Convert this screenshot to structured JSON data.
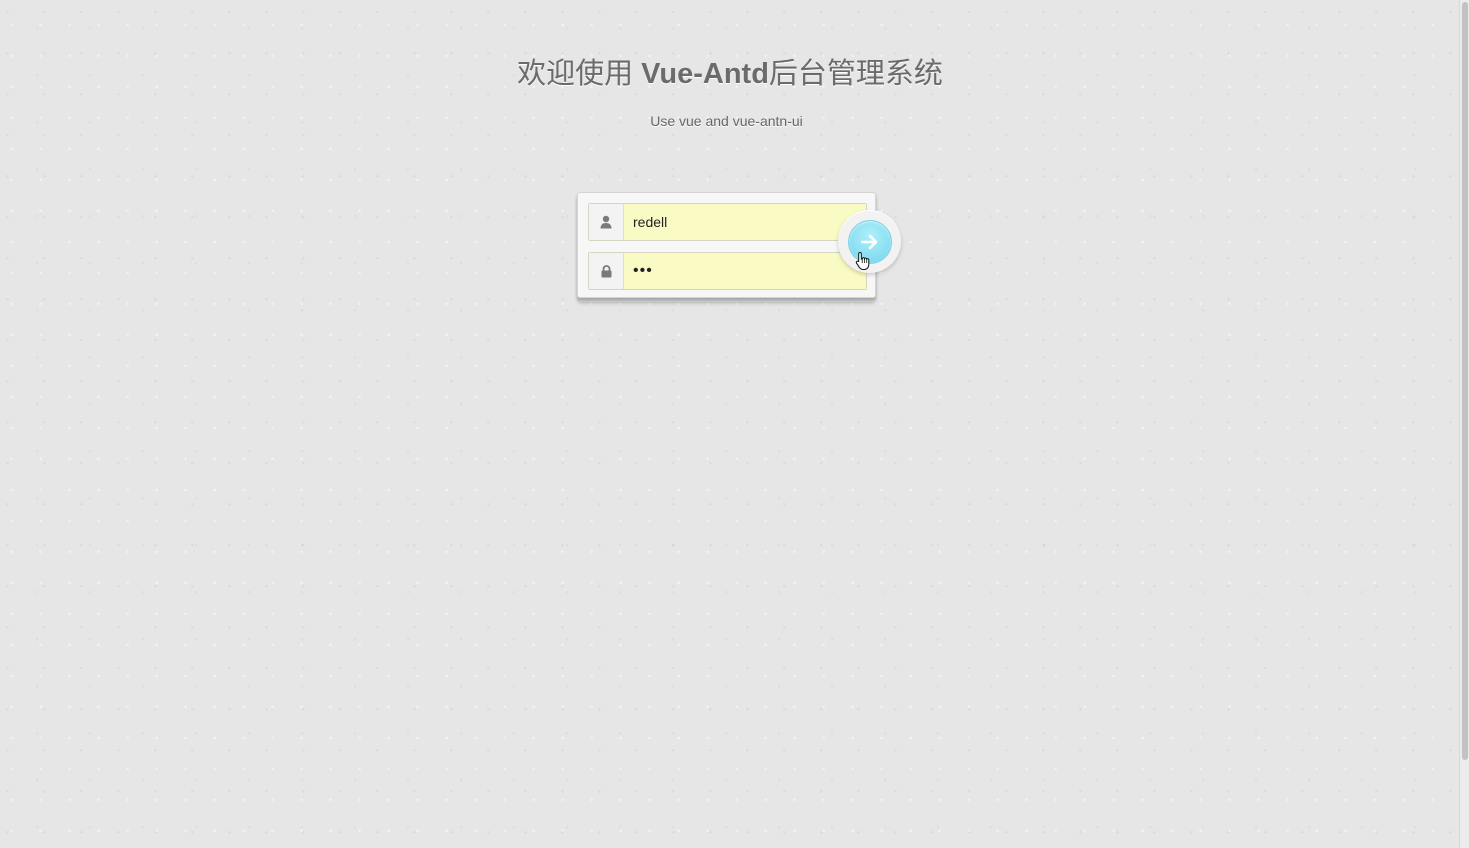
{
  "header": {
    "title_prefix": "欢迎使用 ",
    "title_brand": "Vue-Antd",
    "title_suffix": "后台管理系统",
    "subtitle": "Use vue and vue-antn-ui"
  },
  "login": {
    "username_value": "redell",
    "password_value": "•••",
    "username_icon": "user-icon",
    "password_icon": "lock-icon",
    "submit_icon": "arrow-right-icon"
  },
  "colors": {
    "background": "#e6e6e6",
    "input_autofill": "#fafac5",
    "submit_accent": "#85dcf0"
  }
}
